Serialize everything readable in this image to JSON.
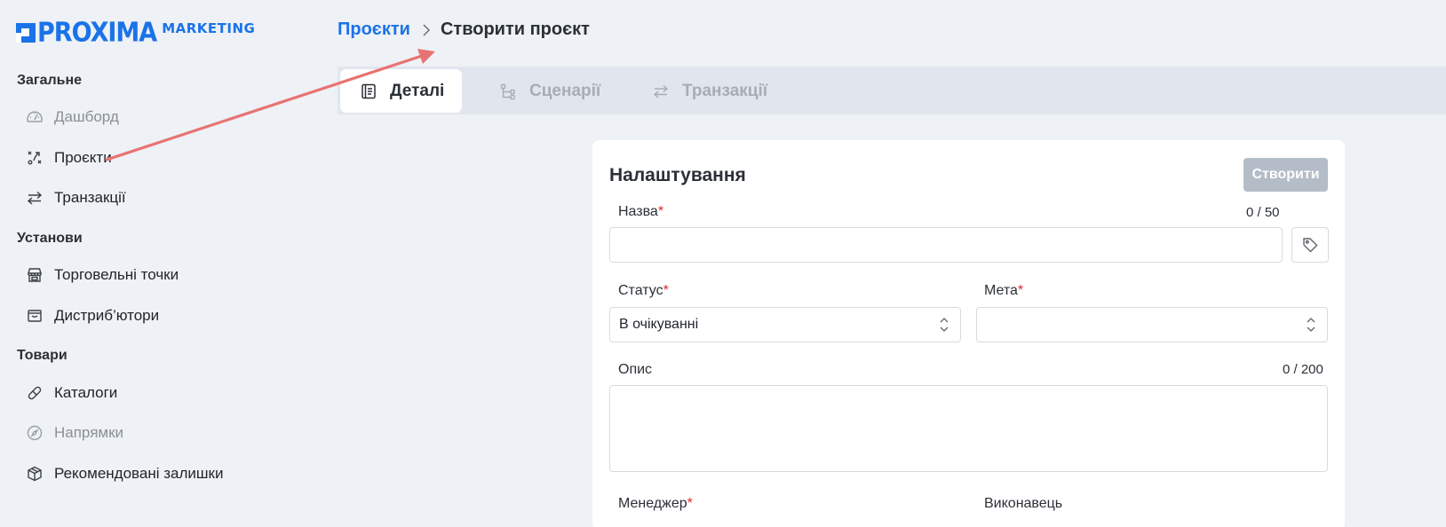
{
  "brand": {
    "name": "PROXIMA",
    "sub": "MARKETING",
    "color": "#1a73e8"
  },
  "sidebar": {
    "sections": [
      {
        "title": "Загальне",
        "items": [
          {
            "label": "Дашборд",
            "icon": "gauge-icon",
            "muted": true
          },
          {
            "label": "Проєкти",
            "icon": "strategy-icon",
            "muted": false
          },
          {
            "label": "Транзакції",
            "icon": "transfer-arrows-icon",
            "muted": false
          }
        ]
      },
      {
        "title": "Установи",
        "items": [
          {
            "label": "Торговельні точки",
            "icon": "store-icon",
            "muted": false
          },
          {
            "label": "Дистриб’ютори",
            "icon": "archive-box-icon",
            "muted": false
          }
        ]
      },
      {
        "title": "Товари",
        "items": [
          {
            "label": "Каталоги",
            "icon": "pill-icon",
            "muted": false
          },
          {
            "label": "Напрямки",
            "icon": "compass-icon",
            "muted": true
          },
          {
            "label": "Рекомендовані залишки",
            "icon": "package-icon",
            "muted": false
          }
        ]
      }
    ]
  },
  "breadcrumb": {
    "parent": "Проєкти",
    "current": "Створити проєкт"
  },
  "tabs": [
    {
      "label": "Деталі",
      "icon": "document-icon",
      "active": true
    },
    {
      "label": "Сценарії",
      "icon": "flow-icon",
      "active": false
    },
    {
      "label": "Транзакції",
      "icon": "transfer-arrows-icon",
      "active": false
    }
  ],
  "form": {
    "title": "Налаштування",
    "create_label": "Створити",
    "name": {
      "label": "Назва",
      "required": "*",
      "counter": "0 / 50",
      "value": ""
    },
    "status": {
      "label": "Статус",
      "required": "*",
      "value": "В очікуванні"
    },
    "goal": {
      "label": "Мета",
      "required": "*",
      "value": ""
    },
    "description": {
      "label": "Опис",
      "counter": "0 / 200",
      "value": ""
    },
    "manager": {
      "label": "Менеджер",
      "required": "*"
    },
    "executor": {
      "label": "Виконавець"
    }
  },
  "annotation": {
    "color": "#e87373"
  }
}
